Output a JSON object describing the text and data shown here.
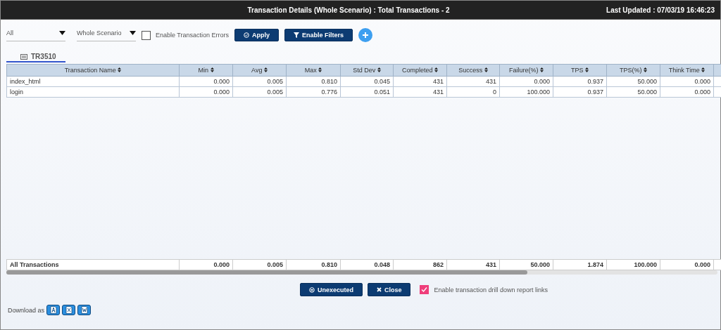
{
  "window": {
    "title": "Transaction Details (Whole Scenario) : Total Transactions - 2",
    "last_updated": "Last Updated : 07/03/19 16:46:23"
  },
  "toolbar": {
    "filter_select": {
      "value": "All"
    },
    "scope_select": {
      "value": "Whole Scenario"
    },
    "error_checkbox": {
      "label": "Enable Transaction Errors",
      "checked": false
    },
    "buttons": [
      "Apply",
      "Enable Filters"
    ]
  },
  "tabs": [
    {
      "label": "TR3510",
      "selected": true
    }
  ],
  "table": {
    "columns": [
      "Transaction Name",
      "Min",
      "Avg",
      "Max",
      "Std Dev",
      "Completed",
      "Success",
      "Failure(%)",
      "TPS",
      "TPS(%)",
      "Think Time"
    ],
    "rows": [
      [
        "index_html",
        "0.000",
        "0.005",
        "0.810",
        "0.045",
        "431",
        "431",
        "0.000",
        "0.937",
        "50.000",
        "0.000"
      ],
      [
        "login",
        "0.000",
        "0.005",
        "0.776",
        "0.051",
        "431",
        "0",
        "100.000",
        "0.937",
        "50.000",
        "0.000"
      ]
    ],
    "footer": [
      "All Transactions",
      "0.000",
      "0.005",
      "0.810",
      "0.048",
      "862",
      "431",
      "50.000",
      "1.874",
      "100.000",
      "0.000"
    ]
  },
  "actions": {
    "buttons": [
      "Unexecuted",
      "Close"
    ],
    "drilldown_checkbox": {
      "label": "Enable transaction drill down report links",
      "checked": true
    }
  },
  "download": {
    "label": "Download as",
    "formats": [
      {
        "kind": "pdf"
      },
      {
        "kind": "excel"
      },
      {
        "kind": "word"
      }
    ]
  }
}
